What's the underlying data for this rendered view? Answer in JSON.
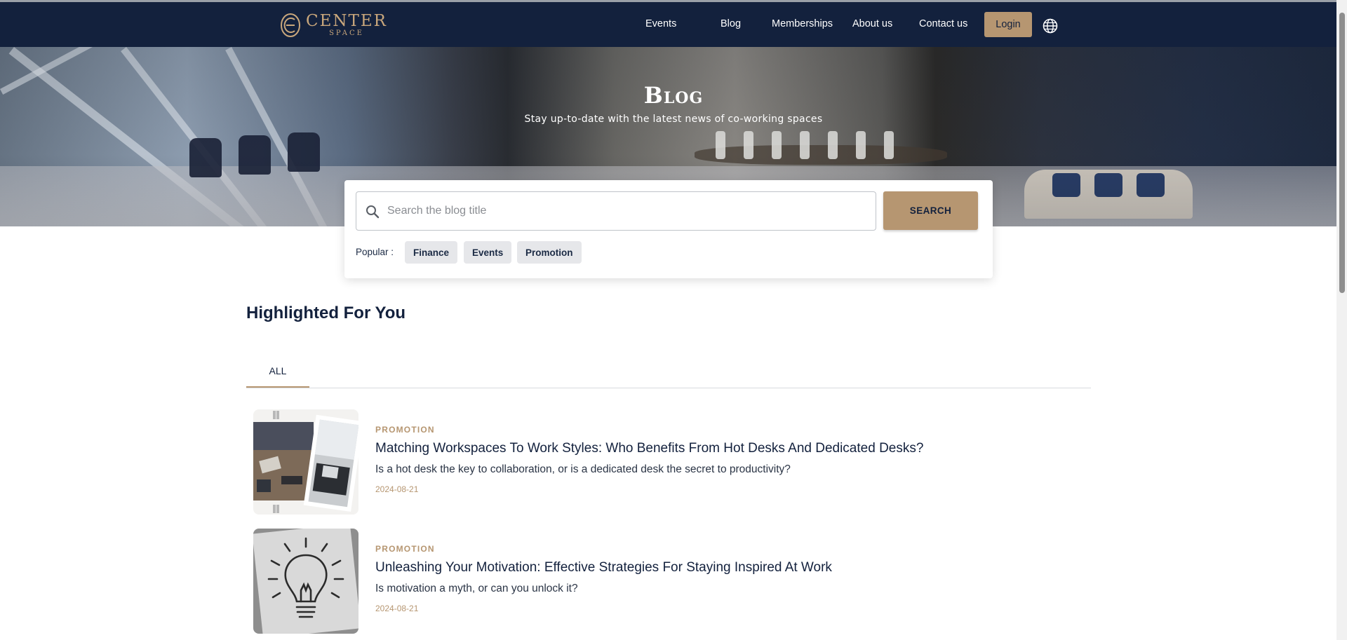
{
  "brand": {
    "name": "CENTER",
    "sub": "SPACE"
  },
  "nav": {
    "items": [
      {
        "label": "Events"
      },
      {
        "label": "Blog"
      },
      {
        "label": "Memberships"
      },
      {
        "label": "About us"
      },
      {
        "label": "Contact us"
      }
    ],
    "login_label": "Login"
  },
  "hero": {
    "title": "Blog",
    "subtitle": "Stay up-to-date with the latest news of co-working spaces"
  },
  "search": {
    "placeholder": "Search the blog title",
    "button_label": "SEARCH",
    "popular_label": "Popular :",
    "popular_tags": [
      "Finance",
      "Events",
      "Promotion"
    ]
  },
  "section": {
    "title": "Highlighted For You",
    "tabs": [
      {
        "label": "ALL"
      }
    ]
  },
  "articles": [
    {
      "category": "PROMOTION",
      "title": "Matching Workspaces To Work Styles: Who Benefits From Hot Desks And Dedicated Desks?",
      "description": "Is a hot desk the key to collaboration, or is a dedicated desk the secret to productivity?",
      "date": "2024-08-21"
    },
    {
      "category": "PROMOTION",
      "title": "Unleashing Your Motivation: Effective Strategies For Staying Inspired At Work",
      "description": "Is motivation a myth, or can you unlock it?",
      "date": "2024-08-21"
    }
  ],
  "colors": {
    "navy": "#13213d",
    "gold": "#b69671",
    "chip_bg": "#e6e7ea"
  },
  "icons": [
    "logo-icon",
    "globe-icon",
    "search-icon"
  ]
}
